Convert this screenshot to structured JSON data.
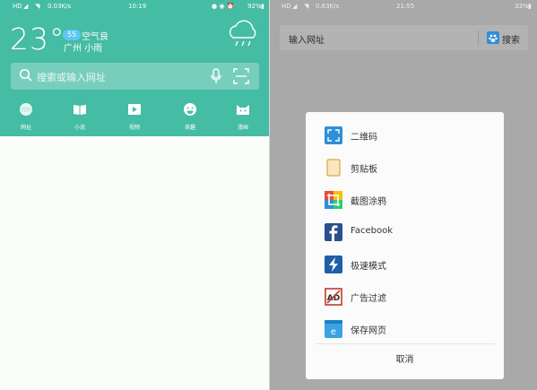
{
  "left": {
    "status": {
      "network": "HD",
      "speed": "0.03K/s",
      "time": "10:19",
      "battery": "92%"
    },
    "weather": {
      "temperature": "23°",
      "aqi_value": "55",
      "aqi_label": "空气良",
      "city": "广州",
      "condition": "小雨",
      "icon": "rain-cloud-icon"
    },
    "search": {
      "placeholder": "搜索或输入网址"
    },
    "nav": [
      {
        "label": "网址",
        "icon": "globe-icon"
      },
      {
        "label": "小说",
        "icon": "book-icon"
      },
      {
        "label": "视频",
        "icon": "play-icon"
      },
      {
        "label": "奇趣",
        "icon": "smiley-icon"
      },
      {
        "label": "漫画",
        "icon": "cat-icon"
      }
    ],
    "colors": {
      "header": "#45bca4",
      "body": "#fafdfa"
    }
  },
  "right": {
    "status": {
      "network": "HD",
      "speed": "0.63K/s",
      "time": "21:55",
      "battery": "33%"
    },
    "urlbar": {
      "placeholder": "输入网址",
      "search_label": "搜索"
    },
    "menu": [
      {
        "label": "二维码",
        "icon": "qr-scan-icon"
      },
      {
        "label": "剪贴板",
        "icon": "clipboard-icon"
      },
      {
        "label": "截图涂鸦",
        "icon": "screenshot-doodle-icon"
      },
      {
        "label": "Facebook",
        "icon": "facebook-icon"
      },
      {
        "label": "极速模式",
        "icon": "lightning-icon"
      },
      {
        "label": "广告过滤",
        "icon": "ad-block-icon"
      },
      {
        "label": "保存网页",
        "icon": "save-page-icon"
      }
    ],
    "cancel_label": "取消",
    "colors": {
      "overlay": "#a9a9a9",
      "sheet": "#fbfbfb",
      "accent": "#2f8fd8"
    }
  }
}
